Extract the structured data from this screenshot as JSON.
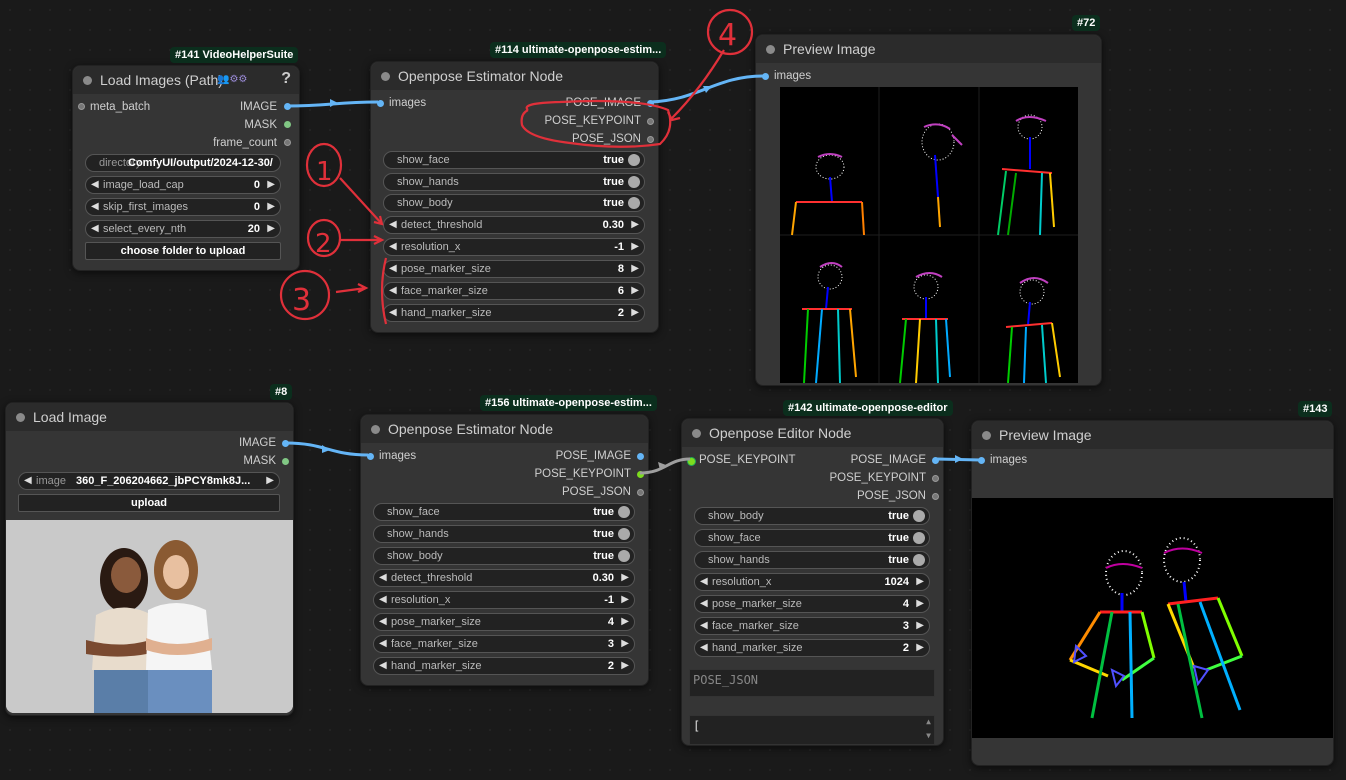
{
  "badges": {
    "n141": "#141 VideoHelperSuite",
    "n114": "#114 ultimate-openpose-estim...",
    "n72": "#72",
    "n8": "#8",
    "n156": "#156 ultimate-openpose-estim...",
    "n142": "#142 ultimate-openpose-editor",
    "n143": "#143"
  },
  "load_images": {
    "title": "Load Images (Path)",
    "help": "?",
    "inputs": [
      "meta_batch"
    ],
    "outputs": [
      "IMAGE",
      "MASK",
      "frame_count"
    ],
    "directory_label": "directory",
    "directory_value": "ComfyUI/output/2024-12-30/",
    "widgets": [
      {
        "name": "image_load_cap",
        "value": "0"
      },
      {
        "name": "skip_first_images",
        "value": "0"
      },
      {
        "name": "select_every_nth",
        "value": "20"
      }
    ],
    "button": "choose folder to upload"
  },
  "estimator1": {
    "title": "Openpose Estimator Node",
    "input": "images",
    "outputs": [
      "POSE_IMAGE",
      "POSE_KEYPOINT",
      "POSE_JSON"
    ],
    "toggles": [
      {
        "name": "show_face",
        "value": "true"
      },
      {
        "name": "show_hands",
        "value": "true"
      },
      {
        "name": "show_body",
        "value": "true"
      }
    ],
    "numbers": [
      {
        "name": "detect_threshold",
        "value": "0.30"
      },
      {
        "name": "resolution_x",
        "value": "-1"
      },
      {
        "name": "pose_marker_size",
        "value": "8"
      },
      {
        "name": "face_marker_size",
        "value": "6"
      },
      {
        "name": "hand_marker_size",
        "value": "2"
      }
    ]
  },
  "preview1": {
    "title": "Preview Image",
    "input": "images"
  },
  "load_image": {
    "title": "Load Image",
    "outputs": [
      "IMAGE",
      "MASK"
    ],
    "image_label": "image",
    "image_value": "360_F_206204662_jbPCY8mk8J...",
    "button": "upload"
  },
  "estimator2": {
    "title": "Openpose Estimator Node",
    "input": "images",
    "outputs": [
      "POSE_IMAGE",
      "POSE_KEYPOINT",
      "POSE_JSON"
    ],
    "toggles": [
      {
        "name": "show_face",
        "value": "true"
      },
      {
        "name": "show_hands",
        "value": "true"
      },
      {
        "name": "show_body",
        "value": "true"
      }
    ],
    "numbers": [
      {
        "name": "detect_threshold",
        "value": "0.30"
      },
      {
        "name": "resolution_x",
        "value": "-1"
      },
      {
        "name": "pose_marker_size",
        "value": "4"
      },
      {
        "name": "face_marker_size",
        "value": "3"
      },
      {
        "name": "hand_marker_size",
        "value": "2"
      }
    ]
  },
  "editor": {
    "title": "Openpose Editor Node",
    "input": "POSE_KEYPOINT",
    "outputs": [
      "POSE_IMAGE",
      "POSE_KEYPOINT",
      "POSE_JSON"
    ],
    "toggles": [
      {
        "name": "show_body",
        "value": "true"
      },
      {
        "name": "show_face",
        "value": "true"
      },
      {
        "name": "show_hands",
        "value": "true"
      }
    ],
    "numbers": [
      {
        "name": "resolution_x",
        "value": "1024"
      },
      {
        "name": "pose_marker_size",
        "value": "4"
      },
      {
        "name": "face_marker_size",
        "value": "3"
      },
      {
        "name": "hand_marker_size",
        "value": "2"
      }
    ],
    "json_placeholder": "POSE_JSON",
    "json_text": "["
  },
  "preview2": {
    "title": "Preview Image",
    "input": "images"
  },
  "annotations": [
    "1",
    "2",
    "3",
    "4"
  ],
  "colors": {
    "image_link": "#64b5f6",
    "keypoint_link": "#9e9e9e",
    "annotation": "#e0303a",
    "badge_bg": "#0b2e1d"
  }
}
